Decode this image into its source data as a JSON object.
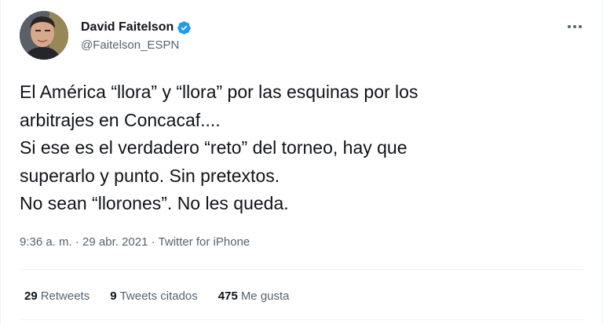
{
  "author": {
    "display_name": "David Faitelson",
    "handle": "@Faitelson_ESPN",
    "verified": true
  },
  "tweet": {
    "lines": [
      "El América “llora” y “llora” por las esquinas por los",
      "arbitrajes en Concacaf....",
      "Si ese es el verdadero “reto” del torneo, hay que",
      "superarlo y punto. Sin pretextos.",
      "No sean “llorones”. No les queda."
    ],
    "time": "9:36 a. m.",
    "separator": "·",
    "date": "29 abr. 2021",
    "source": "Twitter for iPhone"
  },
  "stats": {
    "retweets_count": "29",
    "retweets_label": "Retweets",
    "quotes_count": "9",
    "quotes_label": "Tweets citados",
    "likes_count": "475",
    "likes_label": "Me gusta"
  },
  "colors": {
    "verified": "#1d9bf0",
    "muted_text": "#536471",
    "main_text": "#0f1419",
    "divider": "#eff3f4"
  },
  "icons": {
    "verified": "verified-badge-icon",
    "more": "more-options-icon"
  }
}
